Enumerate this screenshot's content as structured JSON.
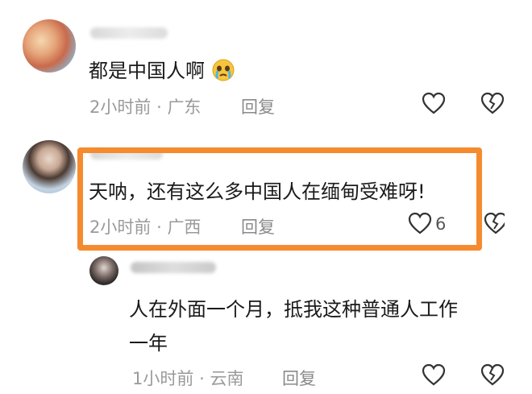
{
  "colors": {
    "highlight": "#f58b2e",
    "meta_text": "#9a9a9a",
    "body_text": "#1a1a1a"
  },
  "comments": [
    {
      "text": "都是中国人啊",
      "emoji": "crying-face",
      "time": "2小时前",
      "location": "广东",
      "reply_label": "回复",
      "icons": [
        "heart-icon",
        "broken-heart-icon"
      ]
    },
    {
      "text": "天呐，还有这么多中国人在缅甸受难呀!",
      "time": "2小时前",
      "location": "广西",
      "reply_label": "回复",
      "like_count": "6",
      "icons": [
        "heart-icon",
        "broken-heart-icon"
      ]
    },
    {
      "text_line1": "人在外面一个月，抵我这种普通人工作",
      "text_line2": "一年",
      "time": "1小时前",
      "location": "云南",
      "reply_label": "回复",
      "icons": [
        "heart-icon",
        "broken-heart-icon"
      ]
    }
  ],
  "separator": "·"
}
